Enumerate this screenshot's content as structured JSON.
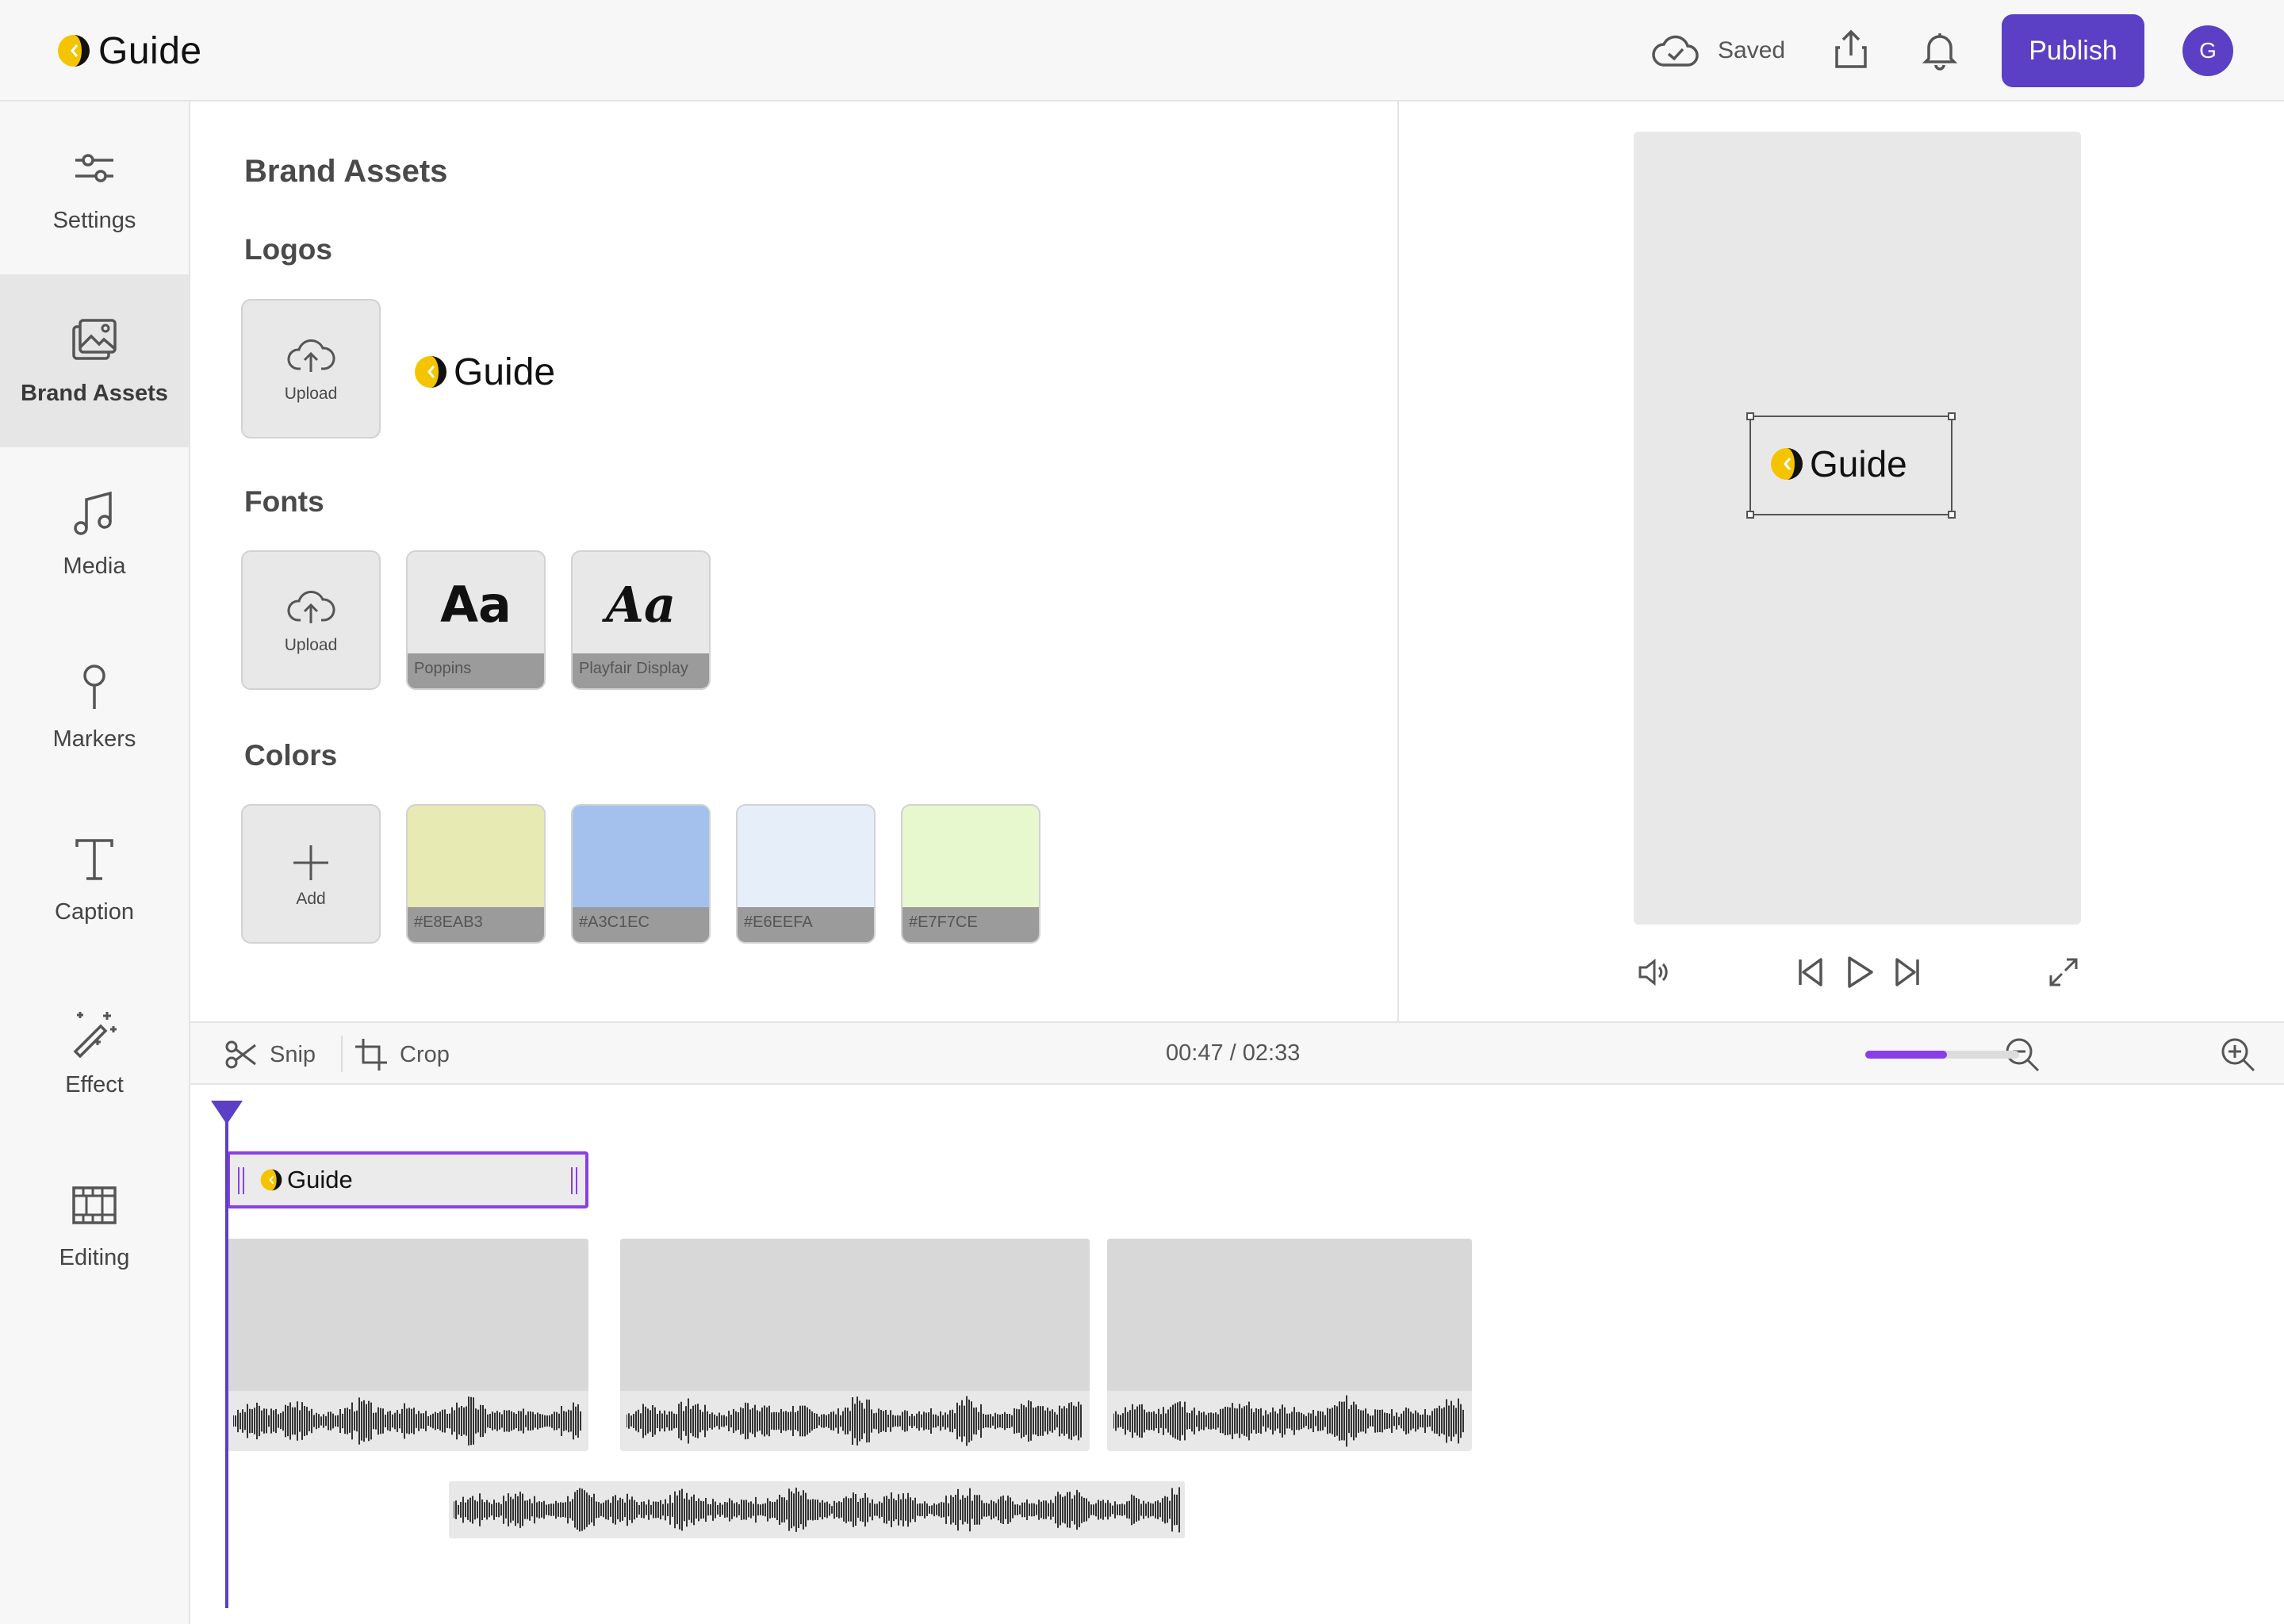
{
  "app": {
    "name": "Guide"
  },
  "topbar": {
    "saved_label": "Saved",
    "publish_label": "Publish",
    "avatar_initial": "G"
  },
  "sidebar": {
    "items": [
      {
        "label": "Settings",
        "icon": "sliders-icon"
      },
      {
        "label": "Brand Assets",
        "icon": "images-icon",
        "active": true
      },
      {
        "label": "Media",
        "icon": "music-note-icon"
      },
      {
        "label": "Markers",
        "icon": "pin-icon"
      },
      {
        "label": "Caption",
        "icon": "text-icon"
      },
      {
        "label": "Effect",
        "icon": "magic-wand-icon"
      },
      {
        "label": "Editing",
        "icon": "film-icon"
      }
    ]
  },
  "assets": {
    "title": "Brand Assets",
    "logos": {
      "heading": "Logos",
      "upload_label": "Upload",
      "logo_text": "Guide"
    },
    "fonts": {
      "heading": "Fonts",
      "upload_label": "Upload",
      "items": [
        {
          "sample": "Aa",
          "name": "Poppins"
        },
        {
          "sample": "Aa",
          "name": "Playfair Display"
        }
      ]
    },
    "colors": {
      "heading": "Colors",
      "add_label": "Add",
      "items": [
        {
          "hex": "#E8EAB3",
          "label": "#E8EAB3"
        },
        {
          "hex": "#A3C1EC",
          "label": "#A3C1EC"
        },
        {
          "hex": "#E6EEFA",
          "label": "#E6EEFA"
        },
        {
          "hex": "#E7F7CE",
          "label": "#E7F7CE"
        }
      ]
    }
  },
  "preview": {
    "logo_text": "Guide"
  },
  "timeline": {
    "snip_label": "Snip",
    "crop_label": "Crop",
    "current_time": "00:47",
    "separator": "/",
    "total_time": "02:33",
    "zoom_level": 0.53,
    "logo_clip_text": "Guide"
  },
  "colors": {
    "accent": "#5b3fc4",
    "accent_light": "#8a3fe6"
  }
}
